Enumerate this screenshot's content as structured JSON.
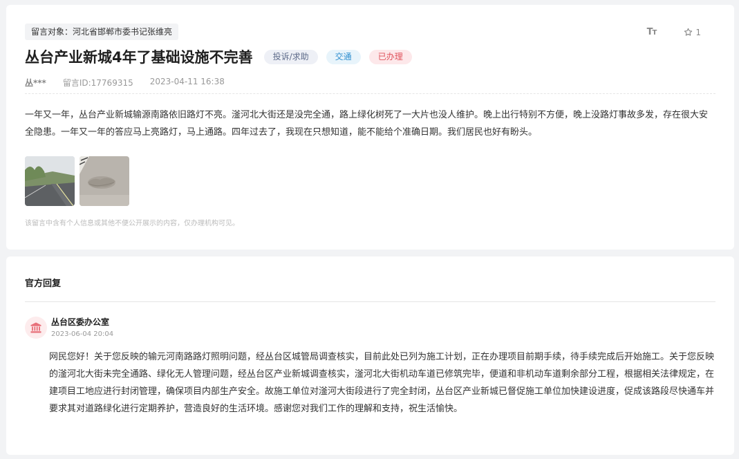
{
  "message": {
    "target": "留言对象：河北省邯郸市委书记张维亮",
    "title": "丛台产业新城4年了基础设施不完善",
    "tags": {
      "type": "投诉/求助",
      "domain": "交通",
      "status": "已办理"
    },
    "font_size_label": "T",
    "font_size_label_small": "T",
    "favorite_count": "1",
    "user": "丛***",
    "message_id": "留言ID:17769315",
    "time": "2023-04-11 16:38",
    "content": "一年又一年，丛台产业新城输源南路依旧路灯不亮。滏河北大街还是没完全通，路上绿化树死了一大片也没人维护。晚上出行特别不方便，晚上没路灯事故多发，存在很大安全隐患。一年又一年的答应马上亮路灯，马上通路。四年过去了，我现在只想知道，能不能给个准确日期。我们居民也好有盼头。",
    "privacy_note": "该留言中含有个人信息或其他不便公开展示的内容，仅办理机构可见。"
  },
  "reply": {
    "section_title": "官方回复",
    "org_name": "丛台区委办公室",
    "time": "2023-06-04 20:04",
    "content": "网民您好！关于您反映的输元河南路路灯照明问题，经丛台区城管局调查核实，目前此处已列为施工计划，正在办理项目前期手续，待手续完成后开始施工。关于您反映的滏河北大街未完全通路、绿化无人管理问题，经丛台区产业新城调查核实，滏河北大街机动车道已修筑完毕，便道和非机动车道剩余部分工程，根据相关法律规定，在建项目工地应进行封闭管理，确保项目内部生产安全。故施工单位对滏河大街段进行了完全封闭，丛台区产业新城已督促施工单位加快建设进度，促成该路段尽快通车并要求其对道路绿化进行定期养护，营造良好的生活环境。感谢您对我们工作的理解和支持，祝生活愉快。"
  },
  "icons": {
    "favorite": "star-icon",
    "font": "font-size-icon",
    "org": "government-building-icon"
  },
  "colors": {
    "status": "#e0525c",
    "domain": "#2f8fcf",
    "type": "#5e6b8a",
    "org_icon": "#e8707a"
  }
}
